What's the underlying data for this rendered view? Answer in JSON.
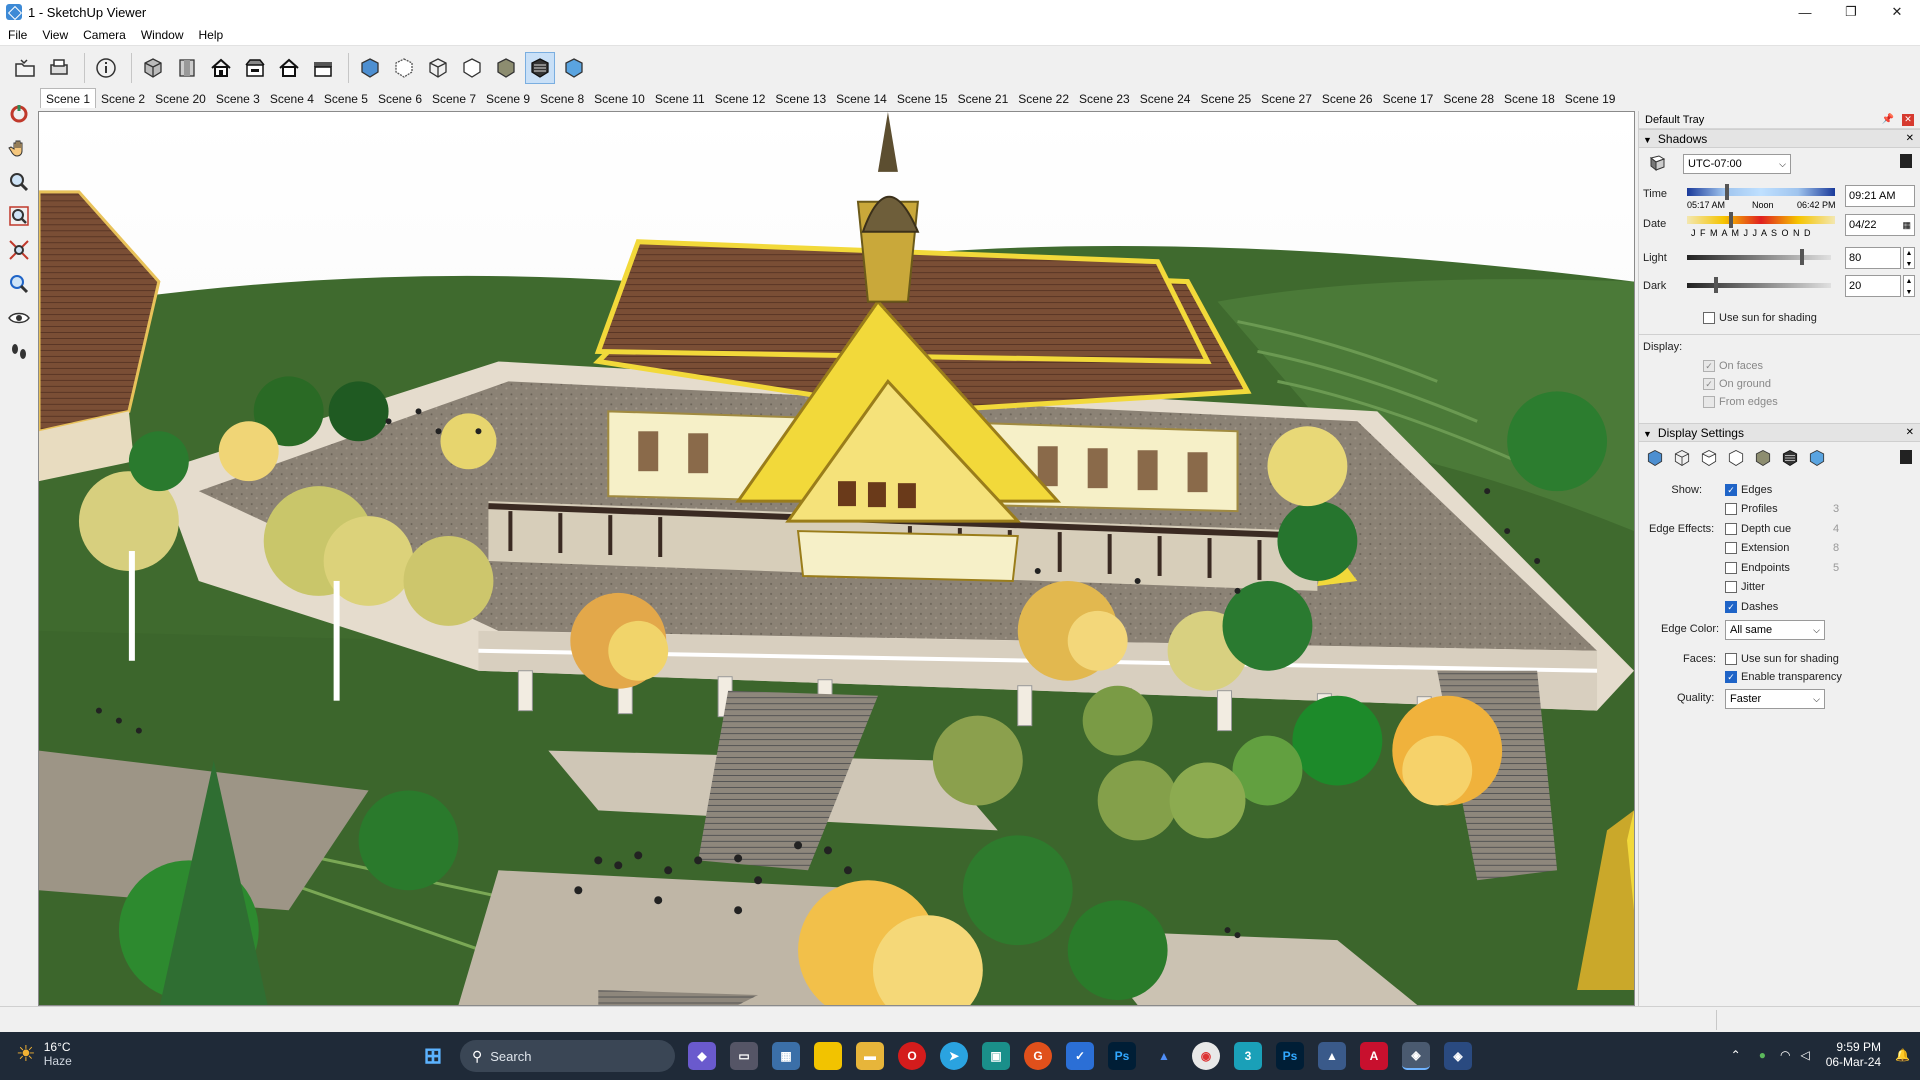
{
  "window": {
    "title": "1 - SketchUp Viewer",
    "controls": [
      "—",
      "❐",
      "✕"
    ]
  },
  "menu": [
    "File",
    "View",
    "Camera",
    "Window",
    "Help"
  ],
  "scenes": [
    "Scene 1",
    "Scene 2",
    "Scene 20",
    "Scene 3",
    "Scene 4",
    "Scene 5",
    "Scene 6",
    "Scene 7",
    "Scene 9",
    "Scene 8",
    "Scene 10",
    "Scene 11",
    "Scene 12",
    "Scene 13",
    "Scene 14",
    "Scene 15",
    "Scene 21",
    "Scene 22",
    "Scene 23",
    "Scene 24",
    "Scene 25",
    "Scene 27",
    "Scene 26",
    "Scene 17",
    "Scene 28",
    "Scene 18",
    "Scene 19"
  ],
  "active_scene": "Scene 1",
  "tray": {
    "title": "Default Tray",
    "shadows": {
      "title": "Shadows",
      "timezone": "UTC-07:00",
      "time_label": "Time",
      "time_sunrise": "05:17 AM",
      "time_noon": "Noon",
      "time_sunset": "06:42 PM",
      "time_value": "09:21 AM",
      "date_label": "Date",
      "months": "J F M A M J J A S O N D",
      "date_value": "04/22",
      "light_label": "Light",
      "light_value": "80",
      "light_level": 0.8,
      "dark_label": "Dark",
      "dark_value": "20",
      "dark_level": 0.2,
      "use_sun": "Use sun for shading",
      "display_label": "Display:",
      "on_faces": "On faces",
      "on_ground": "On ground",
      "from_edges": "From edges"
    },
    "display_settings": {
      "title": "Display Settings",
      "show_label": "Show:",
      "edges": "Edges",
      "profiles": "Profiles",
      "profiles_val": "3",
      "edge_effects_label": "Edge Effects:",
      "depth_cue": "Depth cue",
      "depth_val": "4",
      "extension": "Extension",
      "extension_val": "8",
      "endpoints": "Endpoints",
      "endpoints_val": "5",
      "jitter": "Jitter",
      "dashes": "Dashes",
      "edge_color_label": "Edge Color:",
      "edge_color": "All same",
      "faces_label": "Faces:",
      "faces_use_sun": "Use sun for shading",
      "enable_transparency": "Enable transparency",
      "quality_label": "Quality:",
      "quality": "Faster"
    }
  },
  "taskbar": {
    "weather_temp": "16°C",
    "weather_desc": "Haze",
    "search": "Search",
    "time": "9:59 PM",
    "date": "06-Mar-24"
  },
  "colors": {
    "accent": "#1f64c7",
    "grass": "#3f6a2e",
    "roof": "#7a4e35",
    "gold": "#f2d93a",
    "plaza": "#b9afa0"
  }
}
